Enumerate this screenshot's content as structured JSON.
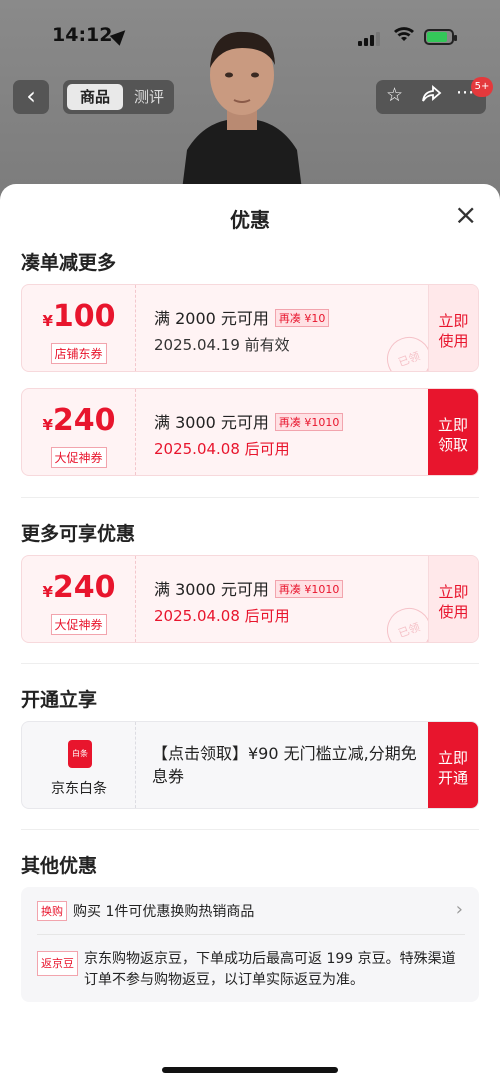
{
  "status_bar": {
    "time": "14:12"
  },
  "top_nav": {
    "tab_goods": "商品",
    "tab_review": "测评",
    "badge": "5+"
  },
  "sheet": {
    "title": "优惠",
    "close": "×"
  },
  "section1": {
    "title": "凑单减更多"
  },
  "coupons": [
    {
      "currency": "¥",
      "amount": "100",
      "tag": "店铺东券",
      "condition": "满 2000 元可用",
      "pill": "再凑 ¥10",
      "date": "2025.04.19 前有效",
      "action": "立即使用",
      "stamp": "已领"
    },
    {
      "currency": "¥",
      "amount": "240",
      "tag": "大促神券",
      "condition": "满 3000 元可用",
      "pill": "再凑 ¥1010",
      "date": "2025.04.08 后可用",
      "action": "立即领取"
    }
  ],
  "section2": {
    "title": "更多可享优惠"
  },
  "coupon3": {
    "currency": "¥",
    "amount": "240",
    "tag": "大促神券",
    "condition": "满 3000 元可用",
    "pill": "再凑 ¥1010",
    "date": "2025.04.08 后可用",
    "action": "立即使用",
    "stamp": "已领"
  },
  "section3": {
    "title": "开通立享"
  },
  "baitiao": {
    "logo_text": "白条",
    "name": "京东白条",
    "text": "【点击领取】¥90 无门槛立减,分期免息券",
    "action": "立即开通"
  },
  "section4": {
    "title": "其他优惠"
  },
  "other": {
    "row1_tag": "换购",
    "row1_text": "购买 1件可优惠换购热销商品",
    "row2_tag": "返京豆",
    "row2_text": "京东购物返京豆，下单成功后最高可返 199 京豆。特殊渠道订单不参与购物返豆，以订单实际返豆为准。"
  },
  "colors": {
    "accent": "#e8152d",
    "coupon_bg": "#fff3f4"
  }
}
